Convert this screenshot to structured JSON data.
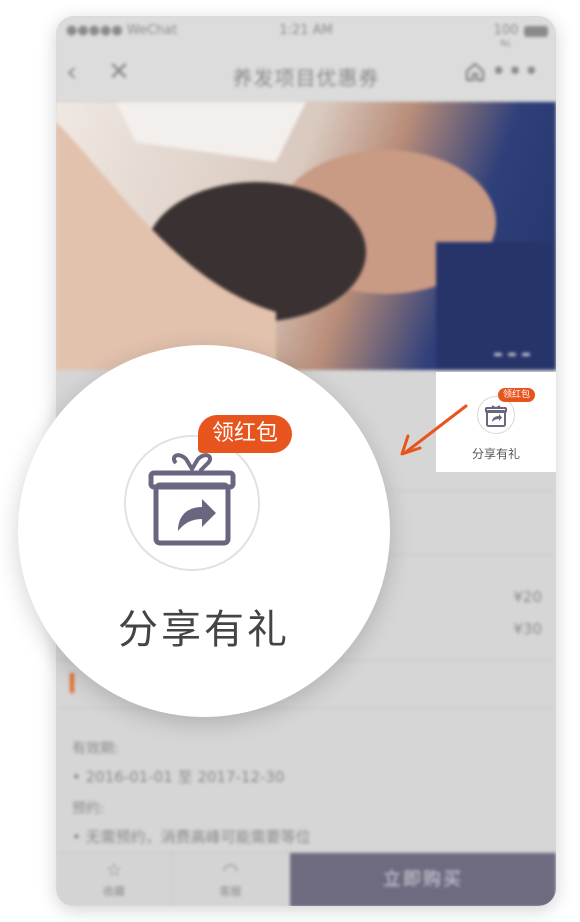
{
  "status_bar": {
    "carrier": "●●●●● WeChat",
    "time": "1:21 AM",
    "battery": "100 %"
  },
  "nav": {
    "title": "养发项目优惠券",
    "back_icon": "back-chevron-icon",
    "close_icon": "close-icon",
    "home_icon": "home-icon",
    "more_icon": "more-icon"
  },
  "list": {
    "price_1": "¥20",
    "price_2": "¥30"
  },
  "validity": {
    "label": "有效期:",
    "range": "• 2016-01-01 至 2017-12-30"
  },
  "booking": {
    "label": "预约:",
    "text": "• 无需预约，消费高峰可能需要等位"
  },
  "bottom_bar": {
    "favorite_label": "收藏",
    "service_label": "客服",
    "buy_label": "立即购买"
  },
  "share": {
    "badge": "领红包",
    "label": "分享有礼",
    "icon": "gift-share-icon"
  },
  "colors": {
    "accent": "#e8541e",
    "buy_button": "#6e6a80"
  }
}
